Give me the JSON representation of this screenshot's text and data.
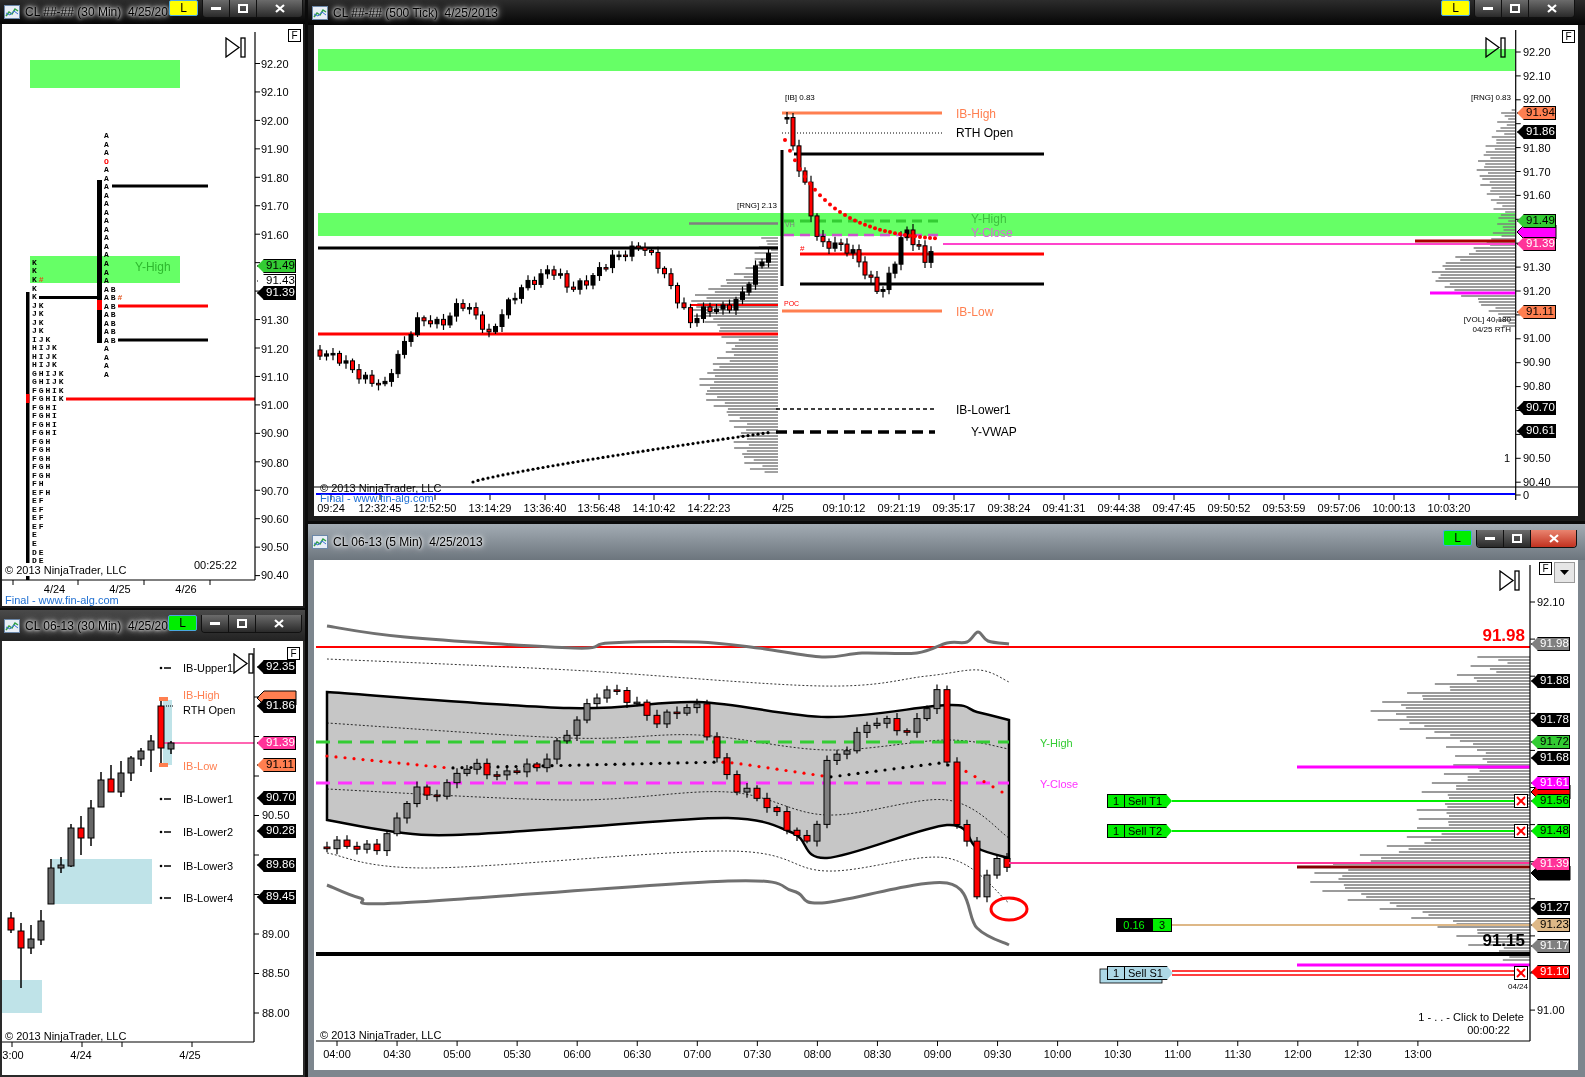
{
  "windows": [
    {
      "kind": "tpo",
      "title": "CL ##-## (30 Min)  4/25/20",
      "active": false,
      "link_button": {
        "label": "L",
        "color": "#ffff00"
      },
      "toggle_label": "F",
      "price_axis": [
        "92.20",
        "92.10",
        "92.00",
        "91.90",
        "91.80",
        "91.70",
        "91.60",
        "91.30",
        "91.20",
        "91.10",
        "91.00",
        "90.90",
        "90.80",
        "90.70",
        "90.60",
        "90.50",
        "90.40"
      ],
      "price_tags": [
        {
          "label": "91.49",
          "color": "#33cc33"
        },
        {
          "label": "91.43",
          "color": "#ffffff"
        },
        {
          "label": "91.39",
          "color": "#000000"
        }
      ],
      "annotations": [
        {
          "text": "Y-High",
          "color": "#2eb82e"
        }
      ],
      "tpo_columns": [
        {
          "rows": [
            {
              "text": "K",
              "kind": "letters"
            },
            {
              "text": "K",
              "kind": "letters"
            },
            {
              "text": "K",
              "kind": "letters",
              "marker": "#"
            },
            {
              "text": "K",
              "kind": "letters"
            },
            {
              "text": "K",
              "kind": "letters"
            },
            {
              "text": "JK",
              "kind": "letters"
            },
            {
              "text": "JK",
              "kind": "letters"
            },
            {
              "text": "JK",
              "kind": "letters"
            },
            {
              "text": "JK",
              "kind": "letters"
            },
            {
              "text": "IJK",
              "kind": "letters"
            },
            {
              "text": "HIJK",
              "kind": "letters"
            },
            {
              "text": "HIJK",
              "kind": "letters"
            },
            {
              "text": "HIJK",
              "kind": "letters"
            },
            {
              "text": "GHIJK",
              "kind": "letters"
            },
            {
              "text": "GHIJK",
              "kind": "letters"
            },
            {
              "text": "FGHIK",
              "kind": "letters"
            },
            {
              "text": "FGHIK",
              "kind": "letters"
            },
            {
              "text": "FGHI",
              "kind": "letters"
            },
            {
              "text": "FGHI",
              "kind": "letters"
            },
            {
              "text": "FGHI",
              "kind": "letters"
            },
            {
              "text": "FGHI",
              "kind": "letters"
            },
            {
              "text": "FGH",
              "kind": "letters"
            },
            {
              "text": "FGH",
              "kind": "letters"
            },
            {
              "text": "FGH",
              "kind": "letters"
            },
            {
              "text": "FGH",
              "kind": "letters"
            },
            {
              "text": "FGH",
              "kind": "letters"
            },
            {
              "text": "FH",
              "kind": "letters"
            },
            {
              "text": "EFH",
              "kind": "letters"
            },
            {
              "text": "EF",
              "kind": "letters"
            },
            {
              "text": "EF",
              "kind": "letters"
            },
            {
              "text": "EF",
              "kind": "letters"
            },
            {
              "text": "EF",
              "kind": "letters"
            },
            {
              "text": "E",
              "kind": "letters"
            },
            {
              "text": "E",
              "kind": "letters"
            },
            {
              "text": "DE",
              "kind": "letters"
            },
            {
              "text": "DE",
              "kind": "letters"
            }
          ]
        },
        {
          "rows": [
            {
              "text": "A",
              "kind": "letters"
            },
            {
              "text": "A",
              "kind": "letters"
            },
            {
              "text": "A",
              "kind": "letters"
            },
            {
              "text": "O",
              "kind": "open"
            },
            {
              "text": "A",
              "kind": "letters"
            },
            {
              "text": "A",
              "kind": "letters"
            },
            {
              "text": "A",
              "kind": "letters"
            },
            {
              "text": "A",
              "kind": "letters"
            },
            {
              "text": "A",
              "kind": "letters"
            },
            {
              "text": "A",
              "kind": "letters"
            },
            {
              "text": "A",
              "kind": "letters"
            },
            {
              "text": "A",
              "kind": "letters"
            },
            {
              "text": "A",
              "kind": "letters"
            },
            {
              "text": "A",
              "kind": "letters"
            },
            {
              "text": "A",
              "kind": "letters"
            },
            {
              "text": "A",
              "kind": "letters"
            },
            {
              "text": "A",
              "kind": "letters"
            },
            {
              "text": "A",
              "kind": "letters"
            },
            {
              "text": "AB",
              "kind": "letters"
            },
            {
              "text": "AB",
              "kind": "letters",
              "marker": "#"
            },
            {
              "text": "AB",
              "kind": "letters"
            },
            {
              "text": "AB",
              "kind": "letters"
            },
            {
              "text": "AB",
              "kind": "letters"
            },
            {
              "text": "AB",
              "kind": "letters"
            },
            {
              "text": "AB",
              "kind": "letters"
            },
            {
              "text": "A",
              "kind": "letters"
            },
            {
              "text": "A",
              "kind": "letters"
            },
            {
              "text": "A",
              "kind": "letters"
            },
            {
              "text": "A",
              "kind": "letters"
            }
          ]
        }
      ],
      "copyright": "© 2013 NinjaTrader, LLC",
      "timer": "00:25:22",
      "time_axis": [
        "4/24",
        "4/25",
        "4/26"
      ],
      "footer_link": "Final - www.fin-alg.com"
    },
    {
      "kind": "candles",
      "title": "CL 06-13 (30 Min)  4/25/20",
      "active": false,
      "link_button": {
        "label": "L",
        "color": "#00ee00"
      },
      "toggle_label": "F",
      "price_tags": [
        {
          "label": "92.35",
          "color": "#000000"
        },
        {
          "label": "91.86",
          "color": "#000000"
        },
        {
          "label": "91.39",
          "color": "#ff3399"
        },
        {
          "label": "91.11",
          "color": "#ff7f50"
        },
        {
          "label": "90.70",
          "color": "#000000"
        },
        {
          "label": "90.28",
          "color": "#000000"
        },
        {
          "label": "89.86",
          "color": "#000000"
        },
        {
          "label": "89.45",
          "color": "#000000"
        }
      ],
      "price_axis": [
        "90.50",
        "89.00",
        "88.50",
        "88.00"
      ],
      "annotations": [
        {
          "text": "IB-Upper1",
          "color": "#000000"
        },
        {
          "text": "IB-High",
          "color": "#ff7f50"
        },
        {
          "text": "RTH Open",
          "color": "#000000"
        },
        {
          "text": "IB-Low",
          "color": "#ff7f50"
        },
        {
          "text": "IB-Lower1",
          "color": "#000000"
        },
        {
          "text": "IB-Lower2",
          "color": "#000000"
        },
        {
          "text": "IB-Lower3",
          "color": "#000000"
        },
        {
          "text": "IB-Lower4",
          "color": "#000000"
        }
      ],
      "copyright": "© 2013 NinjaTrader, LLC",
      "time_axis": [
        "3:00",
        "4/24",
        "4/25"
      ]
    },
    {
      "kind": "ticks",
      "title": "CL ##-## (500 Tick)  4/25/2013",
      "active": false,
      "link_button": {
        "label": "L",
        "color": "#ffff00"
      },
      "toggle_label": "F",
      "price_axis": [
        "92.20",
        "92.10",
        "92.00",
        "91.80",
        "91.70",
        "91.60",
        "91.30",
        "91.20",
        "91.00",
        "90.90",
        "90.80",
        "90.50",
        "90.40",
        "0"
      ],
      "price_tags": [
        {
          "label": "91.94",
          "color": "#ff7f50"
        },
        {
          "label": "91.86",
          "color": "#000000"
        },
        {
          "label": "91.49",
          "color": "#33cc33"
        },
        {
          "label": "91.39",
          "color": "#ff3399"
        },
        {
          "label": "91.11",
          "color": "#ff7f50"
        },
        {
          "label": "90.70",
          "color": "#000000"
        },
        {
          "label": "90.61",
          "color": "#000000"
        }
      ],
      "notes": [
        {
          "text": "[IB] 0.83",
          "kind": "plain"
        },
        {
          "text": "[RNG] 0.83",
          "kind": "plain"
        },
        {
          "text": "[RNG] 2.13",
          "kind": "plain"
        },
        {
          "text": "VH",
          "kind": "faint"
        },
        {
          "text": "#",
          "kind": "alert"
        },
        {
          "text": "POC",
          "kind": "alert"
        },
        {
          "text": "[VOL] 40,180",
          "kind": "plain"
        },
        {
          "text": "04/25 RTH",
          "kind": "plain"
        },
        {
          "text": "1",
          "kind": "plain"
        }
      ],
      "annotations": [
        {
          "text": "IB-High",
          "color": "#ff7f50"
        },
        {
          "text": "RTH Open",
          "color": "#000000"
        },
        {
          "text": "Y-High",
          "color": "#3fbf3f"
        },
        {
          "text": "Y-Close",
          "color": "#d966d9"
        },
        {
          "text": "IB-Low",
          "color": "#ff7f50"
        },
        {
          "text": "IB-Lower1",
          "color": "#000000"
        },
        {
          "text": "Y-VWAP",
          "color": "#000000"
        }
      ],
      "copyright": "© 2013 NinjaTrader, LLC",
      "footer_link": "Final - www.fin-alg.com",
      "time_axis": [
        "09:24",
        "12:32:45",
        "12:52:50",
        "13:14:29",
        "13:36:40",
        "13:56:48",
        "14:10:42",
        "14:22:23",
        "4/25",
        "09:10:12",
        "09:21:19",
        "09:35:17",
        "09:38:24",
        "09:41:31",
        "09:44:38",
        "09:47:45",
        "09:50:52",
        "09:53:59",
        "09:57:06",
        "10:00:13",
        "10:03:20"
      ]
    },
    {
      "kind": "bands",
      "title": "CL 06-13 (5 Min)  4/25/2013",
      "active": true,
      "link_button": {
        "label": "L",
        "color": "#00ee00"
      },
      "toggle_label": "F",
      "price_axis": [
        "92.10",
        "91.00"
      ],
      "price_callouts": [
        {
          "text": "91.98",
          "color": "#ff0000"
        },
        {
          "text": "91.15",
          "color": "#000000"
        }
      ],
      "price_tags": [
        {
          "label": "91.98",
          "color": "#808080"
        },
        {
          "label": "91.88",
          "color": "#000000"
        },
        {
          "label": "91.78",
          "color": "#000000"
        },
        {
          "label": "91.72",
          "color": "#33cc33"
        },
        {
          "label": "91.68",
          "color": "#000000"
        },
        {
          "label": "91.61",
          "color": "#ff00ff"
        },
        {
          "label": "91.56",
          "color": "#00ee00"
        },
        {
          "label": "91.48",
          "color": "#00ee00"
        },
        {
          "label": "91.39",
          "color": "#ff3399"
        },
        {
          "label": "91.27",
          "color": "#000000"
        },
        {
          "label": "91.23",
          "color": "#deb887"
        },
        {
          "label": "91.17",
          "color": "#808080"
        },
        {
          "label": "91.10",
          "color": "#ff0000"
        }
      ],
      "annotations": [
        {
          "text": "Y-High",
          "color": "#33cc33"
        },
        {
          "text": "Y-Close",
          "color": "#ff33ff"
        }
      ],
      "orders": [
        {
          "quantity": "1",
          "label": "Sell T1",
          "kind": "target"
        },
        {
          "quantity": "1",
          "label": "Sell T2",
          "kind": "target"
        },
        {
          "quantity": "1",
          "label": "Sell S1",
          "kind": "stop"
        }
      ],
      "position": {
        "pnl": "0.16",
        "quantity": "3"
      },
      "notes": [
        {
          "text": "04/24",
          "kind": "plain"
        },
        {
          "text": "1 - . . - Click to Delete",
          "kind": "plain"
        }
      ],
      "timer": "00:00:22",
      "copyright": "© 2013 NinjaTrader, LLC",
      "time_axis": [
        "04:00",
        "04:30",
        "05:00",
        "05:30",
        "06:00",
        "06:30",
        "07:00",
        "07:30",
        "08:00",
        "08:30",
        "09:00",
        "09:30",
        "10:00",
        "10:30",
        "11:00",
        "11:30",
        "12:00",
        "12:30",
        "13:00"
      ]
    }
  ]
}
